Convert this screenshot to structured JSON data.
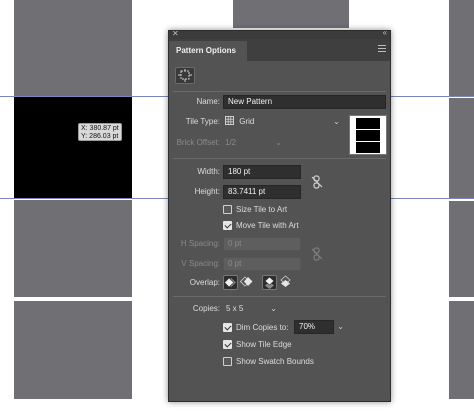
{
  "canvas": {
    "readout": {
      "x": "X: 380.87 pt",
      "y": "Y: 286.03 pt"
    }
  },
  "panel": {
    "tab_title": "Pattern Options",
    "name": {
      "label": "Name:",
      "value": "New Pattern"
    },
    "tile_type": {
      "label": "Tile Type:",
      "value": "Grid"
    },
    "brick_offset": {
      "label": "Brick Offset:",
      "value": "1/2"
    },
    "width": {
      "label": "Width:",
      "value": "180 pt"
    },
    "height": {
      "label": "Height:",
      "value": "83.7411 pt"
    },
    "size_tile_to_art": {
      "label": "Size Tile to Art",
      "checked": false
    },
    "move_tile_with_art": {
      "label": "Move Tile with Art",
      "checked": true
    },
    "h_spacing": {
      "label": "H Spacing:",
      "value": "0 pt"
    },
    "v_spacing": {
      "label": "V Spacing:",
      "value": "0 pt"
    },
    "overlap": {
      "label": "Overlap:"
    },
    "copies": {
      "label": "Copies:",
      "value": "5 x 5"
    },
    "dim_copies": {
      "label": "Dim Copies to:",
      "checked": true,
      "value": "70%"
    },
    "show_tile_edge": {
      "label": "Show Tile Edge",
      "checked": true
    },
    "show_swatch_bounds": {
      "label": "Show Swatch Bounds",
      "checked": false
    }
  },
  "colors": {
    "panel_bg": "#535353",
    "field_bg": "#2f2f2f",
    "tile_gray": "#6f6f74",
    "guide_blue": "#7d86b8"
  }
}
